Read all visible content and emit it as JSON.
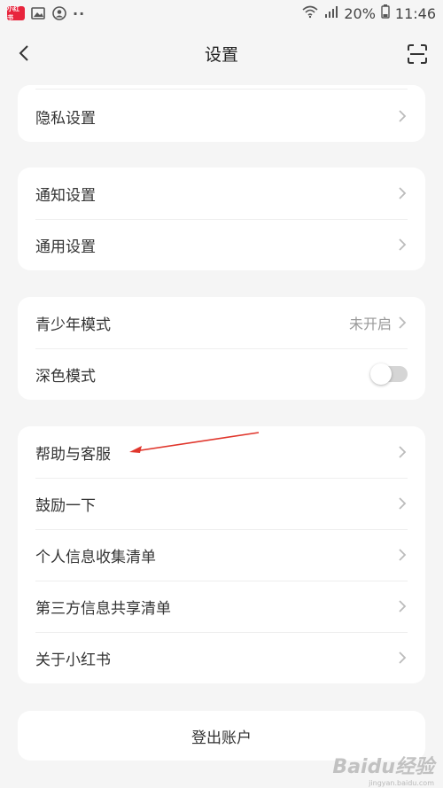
{
  "status_bar": {
    "app_badge": "小红书",
    "battery": "20%",
    "time": "11:46"
  },
  "nav": {
    "title": "设置"
  },
  "groups": {
    "privacy": {
      "items": [
        {
          "label": "隐私设置"
        }
      ]
    },
    "general": {
      "items": [
        {
          "label": "通知设置"
        },
        {
          "label": "通用设置"
        }
      ]
    },
    "modes": {
      "youth": {
        "label": "青少年模式",
        "value": "未开启"
      },
      "dark": {
        "label": "深色模式",
        "enabled": false
      }
    },
    "support": {
      "items": [
        {
          "label": "帮助与客服"
        },
        {
          "label": "鼓励一下"
        },
        {
          "label": "个人信息收集清单"
        },
        {
          "label": "第三方信息共享清单"
        },
        {
          "label": "关于小红书"
        }
      ]
    }
  },
  "logout": {
    "label": "登出账户"
  },
  "annotation": {
    "arrow_color": "#e0362c"
  },
  "watermark": {
    "text": "Baidu经验",
    "subtext": "jingyan.baidu.com"
  }
}
